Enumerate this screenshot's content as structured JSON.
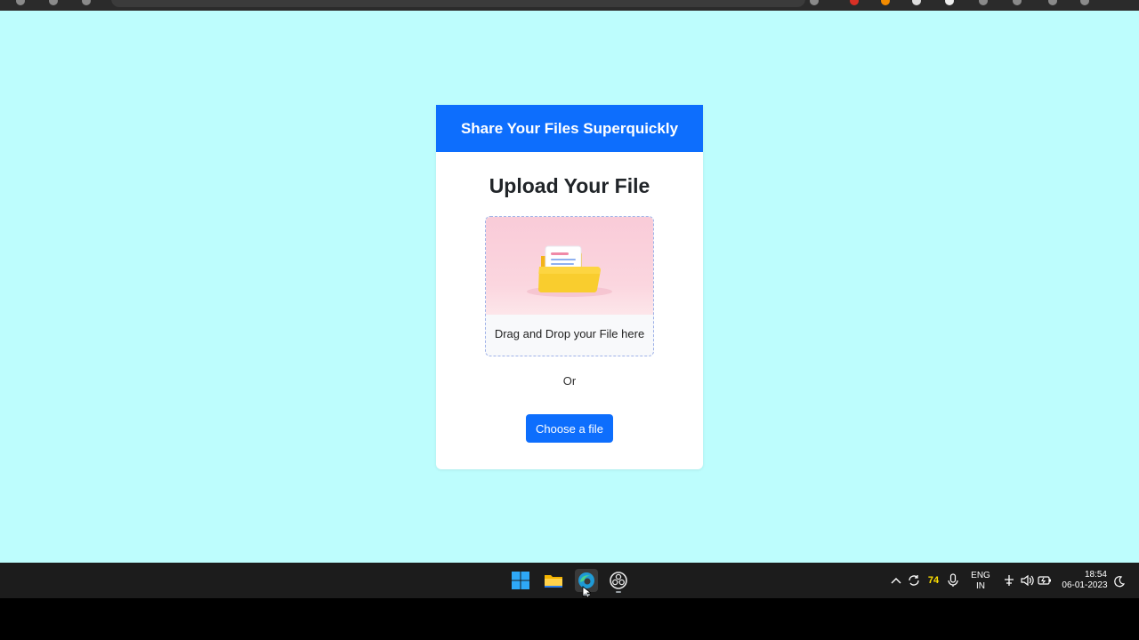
{
  "page": {
    "background": "#bdfdfd",
    "accent": "#0d6efd"
  },
  "card": {
    "header_title": "Share Your Files Superquickly",
    "title": "Upload Your File",
    "dropzone_text": "Drag and Drop your File here",
    "or_text": "Or",
    "choose_button_label": "Choose a file",
    "dropzone_icon": "folder-with-document-icon"
  },
  "taskbar": {
    "apps": [
      "windows-start-icon",
      "file-explorer-icon",
      "edge-browser-icon",
      "obs-studio-icon"
    ],
    "tray": {
      "chevron_icon": "chevron-up-icon",
      "sync_icon": "sync-icon",
      "badge_value": "74",
      "mic_icon": "microphone-icon",
      "language_line1": "ENG",
      "language_line2": "IN",
      "network_icon": "network-icon",
      "volume_icon": "volume-icon",
      "battery_icon": "battery-icon",
      "time": "18:54",
      "date": "06-01-2023",
      "night_light_icon": "moon-icon"
    }
  }
}
